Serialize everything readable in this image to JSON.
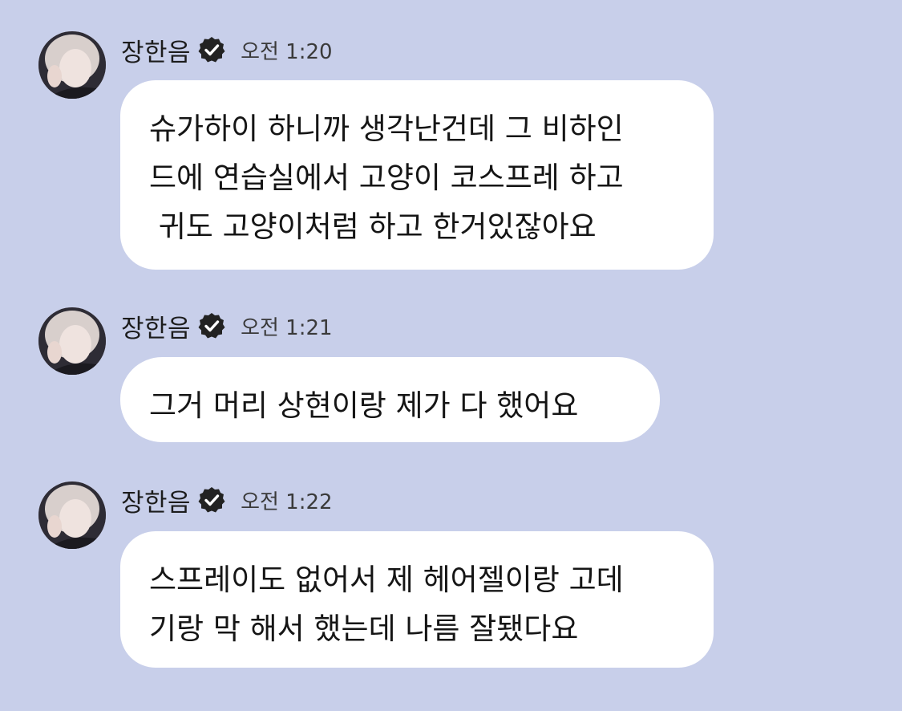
{
  "messages": [
    {
      "sender": "장한음",
      "time": "오전 1:20",
      "text": "슈가하이 하니까 생각난건데 그 비하인\n드에 연습실에서 고양이 코스프레 하고\n 귀도 고양이처럼 하고 한거있잖아요"
    },
    {
      "sender": "장한음",
      "time": "오전 1:21",
      "text": "그거 머리 상현이랑 제가 다 했어요"
    },
    {
      "sender": "장한음",
      "time": "오전 1:22",
      "text": "스프레이도 없어서 제 헤어젤이랑 고데\n기랑 막 해서 했는데 나름 잘됐다요"
    }
  ],
  "icons": {
    "verified": "verified-badge-icon",
    "avatar": "avatar"
  },
  "colors": {
    "background": "#c8cfea",
    "bubble": "#ffffff",
    "verified_badge": "#222222"
  }
}
